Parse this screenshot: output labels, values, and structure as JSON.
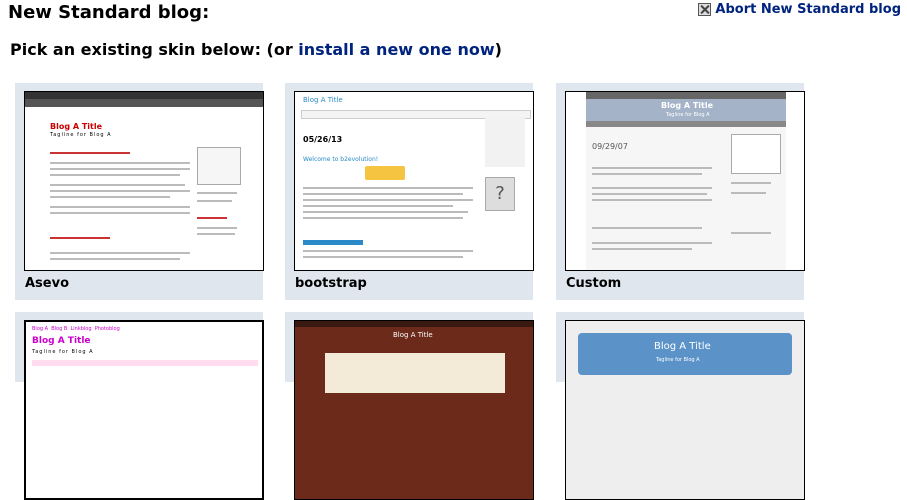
{
  "header": {
    "title": "New Standard blog:",
    "abort_label": "Abort New Standard blog"
  },
  "prompt": {
    "prefix": "Pick an existing skin below: (or ",
    "link": "install a new one now",
    "suffix": ")"
  },
  "skins": [
    {
      "name": "Asevo",
      "preview": {
        "title": "Blog A Title",
        "tagline": "Tagline for Blog A"
      }
    },
    {
      "name": "bootstrap",
      "preview": {
        "title": "Blog A Title",
        "heading": "Welcome to b2evolution!",
        "date": "05/26/13"
      }
    },
    {
      "name": "Custom",
      "preview": {
        "title": "Blog A Title",
        "tagline": "Tagline for Blog A",
        "date": "09/29/07"
      }
    },
    {
      "name": "",
      "preview": {
        "title": "Blog A Title",
        "tagline": "Tagline for Blog A"
      }
    },
    {
      "name": "",
      "preview": {
        "title": "Blog A Title"
      }
    },
    {
      "name": "",
      "preview": {
        "title": "Blog A Title",
        "tagline": "Tagline for Blog A"
      }
    }
  ],
  "colors": {
    "link": "#00237d",
    "card_bg": "#dfe6ee"
  }
}
